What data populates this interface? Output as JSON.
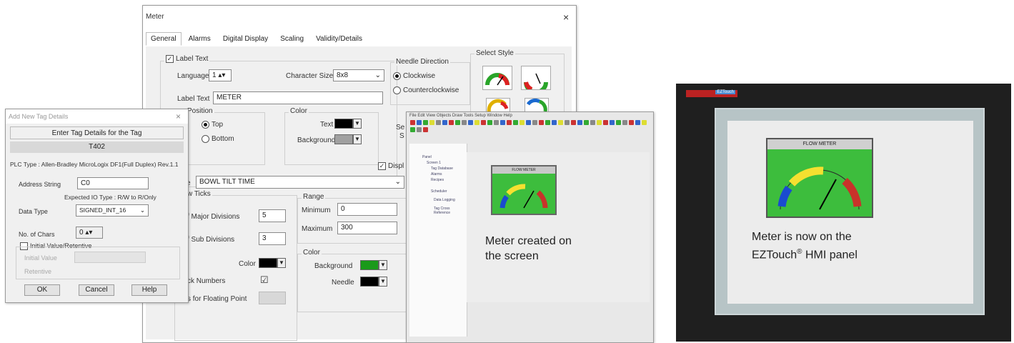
{
  "meter_dialog": {
    "title": "Meter",
    "close": "×",
    "tabs": [
      "General",
      "Alarms",
      "Digital Display",
      "Scaling",
      "Validity/Details"
    ],
    "label_text_check": "Label Text",
    "language_label": "Language",
    "language_value": "1",
    "char_size_label": "Character Size",
    "char_size_value": "8x8",
    "label_text_label": "Label Text",
    "label_text_value": "METER",
    "position_legend": "Position",
    "pos_top": "Top",
    "pos_bottom": "Bottom",
    "color_legend": "Color",
    "text_label": "Text",
    "background_label": "Background",
    "needle_dir_legend": "Needle Direction",
    "clockwise": "Clockwise",
    "counterclockwise": "Counterclockwise",
    "select_style_legend": "Select Style",
    "select_cut": "Se",
    "select_cut2": "S",
    "display_cut": "Displ",
    "tag_label_cut": "e",
    "tag_value": "BOWL TILT TIME",
    "ticks_legend": "w Ticks",
    "major_label": "f Major Divisions",
    "major_value": "5",
    "sub_label": "f Sub Divisions",
    "sub_value": "3",
    "tick_color_label": "Color",
    "tick_numbers_label": "ck Numbers",
    "tick_numbers_mark": "☑",
    "float_label": "s for Floating Point",
    "range_legend": "Range",
    "minimum_label": "Minimum",
    "minimum_value": "0",
    "maximum_label": "Maximum",
    "maximum_value": "300",
    "color2_legend": "Color",
    "bg2_label": "Background",
    "needle_label": "Needle",
    "colors": {
      "text": "#000000",
      "background": "#a0a0a0",
      "tick": "#000000",
      "range_bg": "#1a9a1a",
      "needle": "#000000"
    }
  },
  "tag_dialog": {
    "title": "Add New Tag Details",
    "close": "×",
    "heading": "Enter Tag Details for the Tag",
    "tag_name": "T402",
    "plc_type": "PLC Type : Allen-Bradley MicroLogix DF1(Full Duplex) Rev.1.1",
    "address_label": "Address String",
    "address_value": "C0",
    "expected_type": "Expected IO Type : R/W to R/Only",
    "data_type_label": "Data Type",
    "data_type_value": "SIGNED_INT_16",
    "chars_label": "No. of Chars",
    "chars_value": "0",
    "initial_check": "Initial Value/Retentive",
    "initial_value_label": "Initial Value",
    "retentive_label": "Retentive",
    "ok": "OK",
    "cancel": "Cancel",
    "help": "Help"
  },
  "editor": {
    "menu": "File  Edit  View  Objects  Draw  Tools  Setup  Window  Help",
    "meter_title": "FLOW METER",
    "tree_items": [
      "Panel",
      "Screen 1",
      "Tag Database",
      "Alarms",
      "Recipes",
      "Scheduler",
      "Data Logging",
      "Tag Cross Reference"
    ],
    "caption_line1": "Meter created on",
    "caption_line2": "the screen"
  },
  "hmi": {
    "logo": "EZTouch",
    "meter_title": "FLOW METER",
    "caption_line1": "Meter is now on the",
    "caption_line2_a": "EZTouch",
    "caption_line2_sup": "®",
    "caption_line2_b": " HMI panel"
  }
}
